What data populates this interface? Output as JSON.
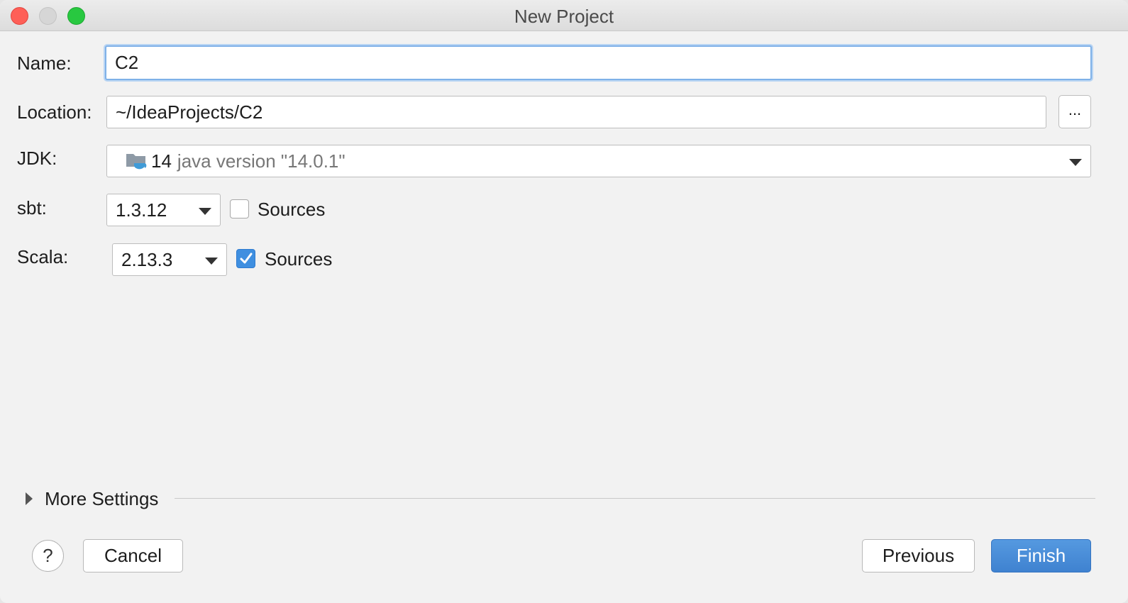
{
  "window": {
    "title": "New Project"
  },
  "form": {
    "name": {
      "label": "Name:",
      "value": "C2"
    },
    "location": {
      "label": "Location:",
      "value": "~/IdeaProjects/C2",
      "browse_label": "..."
    },
    "jdk": {
      "label": "JDK:",
      "version": "14",
      "detail": "java version \"14.0.1\"",
      "icon": "jdk-folder-icon"
    },
    "sbt": {
      "label": "sbt:",
      "version": "1.3.12",
      "sources_label": "Sources",
      "sources_checked": false
    },
    "scala": {
      "label": "Scala:",
      "version": "2.13.3",
      "sources_label": "Sources",
      "sources_checked": true
    }
  },
  "more_settings": {
    "label": "More Settings",
    "expanded": false
  },
  "footer": {
    "help_label": "?",
    "cancel_label": "Cancel",
    "previous_label": "Previous",
    "finish_label": "Finish"
  },
  "colors": {
    "accent": "#3f82d0",
    "focus_ring": "#7fb1e8",
    "window_bg": "#f2f2f2"
  }
}
